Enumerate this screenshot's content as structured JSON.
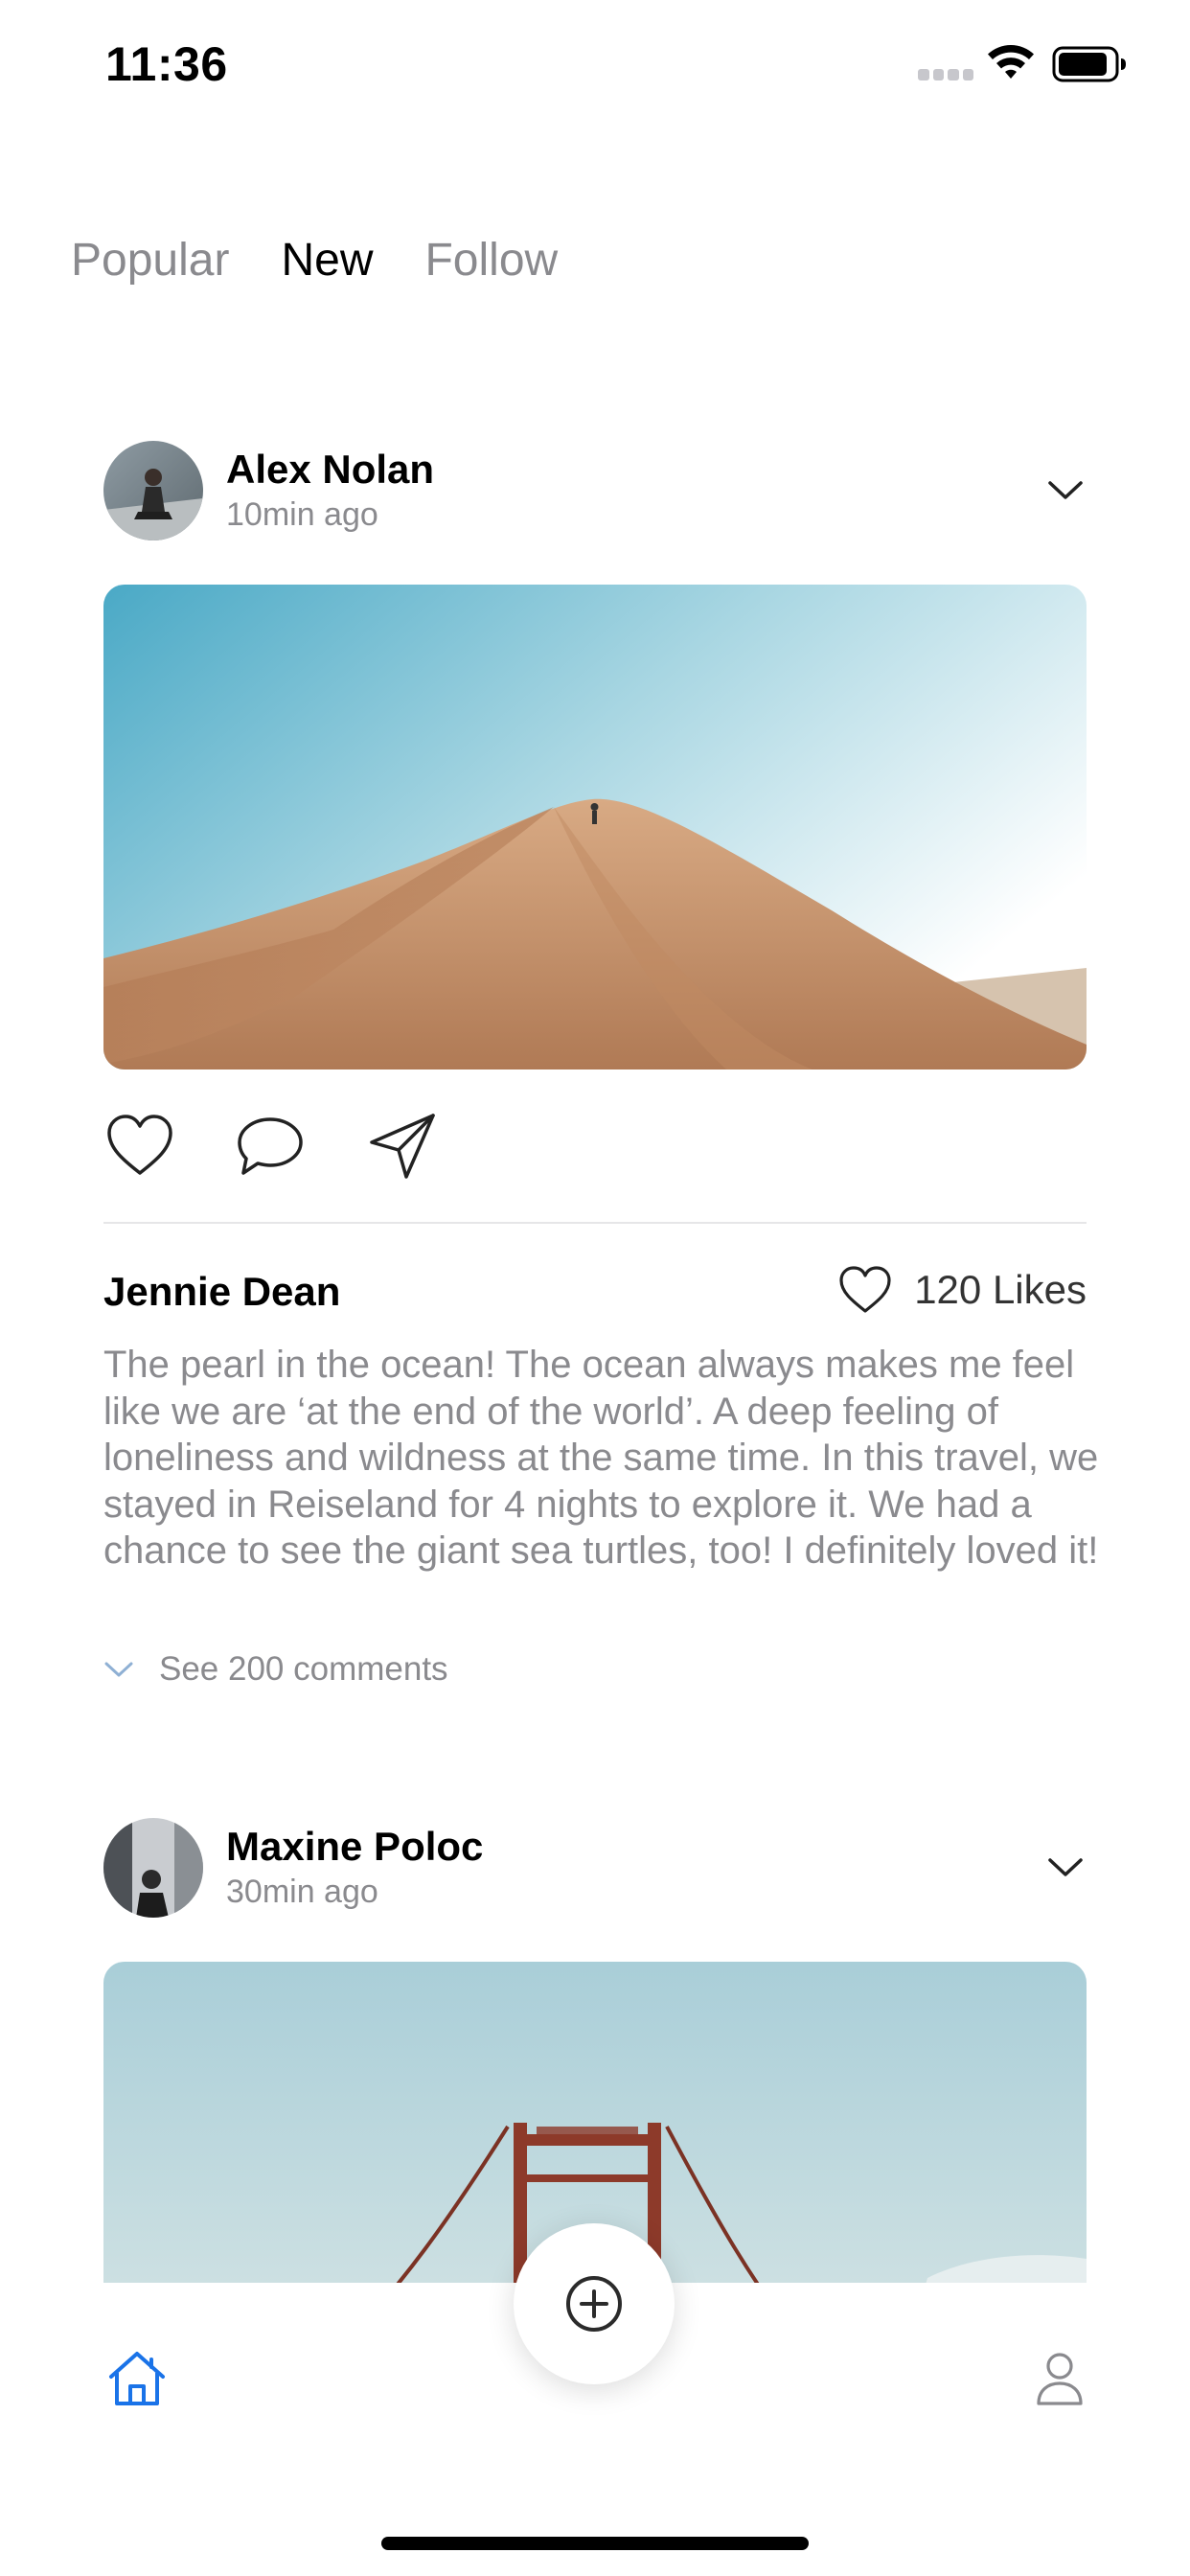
{
  "status_bar": {
    "time": "11:36"
  },
  "tabs": [
    {
      "label": "Popular",
      "active": false
    },
    {
      "label": "New",
      "active": true
    },
    {
      "label": "Follow",
      "active": false
    }
  ],
  "posts": [
    {
      "author": "Alex Nolan",
      "time_ago": "10min ago",
      "image": "desert-dune-photo",
      "commenter": "Jennie Dean",
      "likes_label": "120 Likes",
      "caption": "The pearl in the ocean! The ocean always makes me feel like we are ‘at the end of the world’. A deep feeling of loneliness and wildness at the same time. In this travel, we stayed in Reiseland for 4 nights to explore it. We had a chance to see the giant sea turtles, too! I definitely loved it!",
      "see_comments": "See 200 comments"
    },
    {
      "author": "Maxine Poloc",
      "time_ago": "30min ago",
      "image": "golden-gate-bridge-photo"
    }
  ],
  "icons": {
    "like": "heart-icon",
    "comment": "chat-bubble-icon",
    "share": "paper-plane-icon",
    "menu": "chevron-down-icon",
    "add": "plus-circle-icon",
    "home": "home-icon",
    "profile": "person-icon"
  },
  "colors": {
    "accent": "#1a73e8",
    "muted_text": "#8a8a8e",
    "divider": "#e6e6e8"
  }
}
